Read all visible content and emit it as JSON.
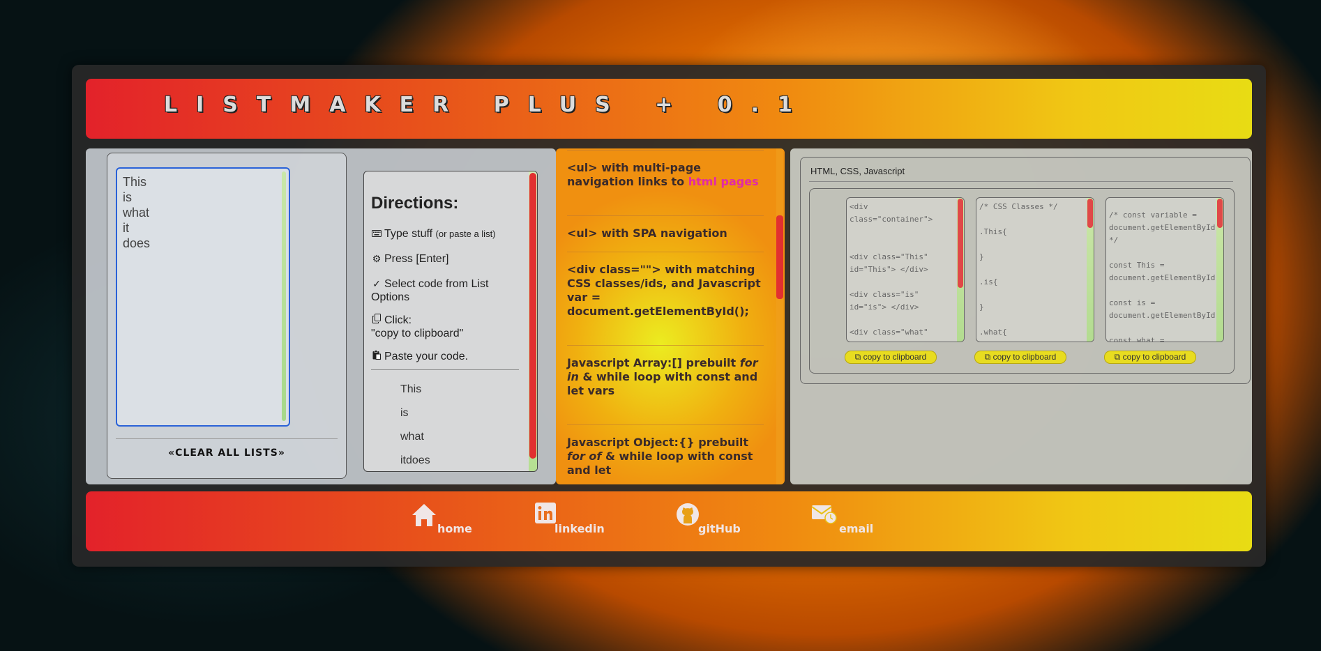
{
  "header": {
    "title": "LISTMAKER PLUS + 0.1"
  },
  "input": {
    "lines": [
      "This",
      "is",
      "what",
      "it",
      "does"
    ],
    "clear_label": "«CLEAR ALL LISTS»"
  },
  "directions": {
    "title": "Directions:",
    "steps": [
      {
        "icon": "keyboard-icon",
        "text": "Type stuff",
        "note": "(or paste a list)"
      },
      {
        "icon": "gear-icon",
        "text": "Press [Enter]"
      },
      {
        "icon": "check-icon",
        "text": "Select code from List Options"
      },
      {
        "icon": "copy-icon",
        "text": "Click:",
        "text2": "\"copy to clipboard\""
      },
      {
        "icon": "paste-icon",
        "text": "Paste your code."
      }
    ],
    "preview_items": [
      "This",
      "is",
      "what",
      "itdoes"
    ]
  },
  "options": [
    {
      "pre": "<ul> with multi-page navigation links to ",
      "accent": "html pages"
    },
    {
      "pre": "<ul> with SPA navigation"
    },
    {
      "pre": "<div class=\"\"> with matching CSS classes/ids, and Javascript var = document.getElementById();"
    },
    {
      "pre": "Javascript Array:[] prebuilt ",
      "em": "for in",
      "post": " & while loop with const and let vars"
    },
    {
      "pre": "Javascript Object:{} prebuilt ",
      "em": "for of",
      "post": " & while loop with const and let"
    }
  ],
  "code": {
    "title": "HTML, CSS, Javascript",
    "html_code": "<div\nclass=\"container\">\n\n\n<div class=\"This\"\nid=\"This\"> </div>\n\n<div class=\"is\"\nid=\"is\"> </div>\n\n<div class=\"what\"",
    "css_code": "/* CSS Classes */\n\n.This{\n\n}\n\n.is{\n\n}\n\n.what{",
    "js_code": "/* const variable =\ndocument.getElementById\n*/\n\nconst This =\ndocument.getElementById\n\nconst is =\ndocument.getElementById\n\nconst what =\ndocument.getElementById",
    "copy_label": "copy to clipboard"
  },
  "footer": {
    "links": [
      {
        "label": "home",
        "icon": "home-icon"
      },
      {
        "label": "linkedin",
        "icon": "linkedin-icon"
      },
      {
        "label": "gitHub",
        "icon": "github-icon"
      },
      {
        "label": "email",
        "icon": "email-icon"
      }
    ]
  }
}
